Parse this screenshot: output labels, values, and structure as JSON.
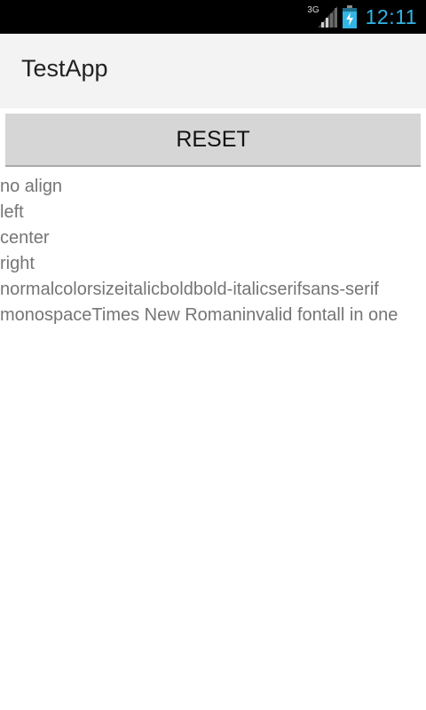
{
  "status_bar": {
    "network_label": "3G",
    "time": "12:11",
    "icons": [
      "signal-icon",
      "battery-charging-icon"
    ],
    "colors": {
      "background": "#000000",
      "clock": "#33b5e5",
      "battery": "#33b5e5"
    }
  },
  "action_bar": {
    "title": "TestApp"
  },
  "reset_button": {
    "label": "RESET"
  },
  "text_lines": [
    "no align",
    "left",
    "center",
    "right",
    "normalcolorsizeitalicboldbold-italicserifsans-serif",
    "monospaceTimes New Romaninvalid fontall in one"
  ]
}
